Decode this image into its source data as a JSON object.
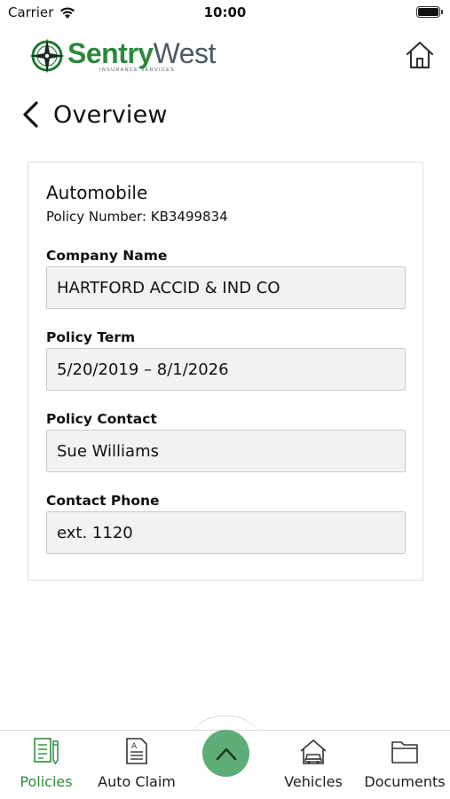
{
  "status_bar": {
    "carrier": "Carrier",
    "time": "10:00"
  },
  "header": {
    "logo_word_1": "Sentry",
    "logo_word_2": "West",
    "logo_subtitle": "INSURANCE SERVICES",
    "page_title": "Overview",
    "home_icon": "home-icon",
    "back_icon": "chevron-left-icon"
  },
  "policy": {
    "type": "Automobile",
    "number_line": "Policy Number: KB3499834",
    "fields": [
      {
        "label": "Company Name",
        "value": "HARTFORD ACCID & IND CO"
      },
      {
        "label": "Policy Term",
        "value": "5/20/2019 – 8/1/2026"
      },
      {
        "label": "Policy Contact",
        "value": "Sue Williams"
      },
      {
        "label": "Contact Phone",
        "value": "ext. 1120"
      }
    ]
  },
  "tabs": [
    {
      "label": "Policies",
      "icon": "policies-icon",
      "active": true
    },
    {
      "label": "Auto Claim",
      "icon": "auto-claim-icon",
      "active": false
    },
    {
      "label": "Vehicles",
      "icon": "vehicles-icon",
      "active": false
    },
    {
      "label": "Documents",
      "icon": "documents-icon",
      "active": false
    }
  ],
  "center_button_icon": "chevron-up-icon",
  "colors": {
    "brand_green": "#2a8a3c",
    "active_tab": "#2e8b3d",
    "center_button": "#5fad76",
    "field_bg": "#f2f2f2"
  }
}
